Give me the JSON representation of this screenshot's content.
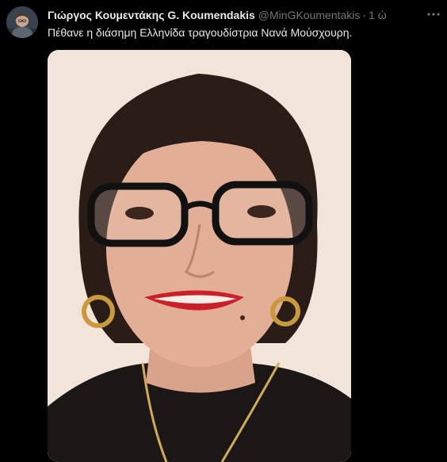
{
  "tweet": {
    "author": {
      "display_name": "Γιώργος Κουμεντάκης G. Koumendakis",
      "handle": "@MinGKoumentakis",
      "avatar_icon": "user-avatar-icon"
    },
    "separator": "·",
    "timestamp": "1 ώ",
    "text": "Πέθανε η διάσημη Ελληνίδα τραγουδίστρια Νανά Μούσχουρη.",
    "more_icon": "more-horizontal-icon",
    "media": {
      "kind": "photo",
      "subject": "portrait"
    }
  },
  "colors": {
    "background": "#000000",
    "primary_text": "#e7e9ea",
    "secondary_text": "#71767b"
  }
}
